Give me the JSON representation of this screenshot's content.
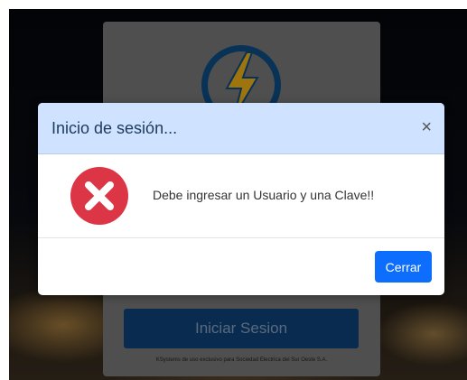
{
  "login": {
    "button_label": "Iniciar Sesion",
    "footer_note": "KSystems de uso exclusivo para Sociedad Electrica del Sur Oeste S.A."
  },
  "modal": {
    "title": "Inicio de sesión...",
    "close_glyph": "×",
    "message": "Debe ingresar un Usuario y una Clave!!",
    "close_button_label": "Cerrar",
    "icon": "error-x-icon"
  },
  "colors": {
    "modal_header_bg": "#cfe2ff",
    "primary_button": "#0d6efd",
    "error_red": "#dc3545",
    "logo_blue": "#0d4e85",
    "logo_yellow": "#f2b315"
  }
}
